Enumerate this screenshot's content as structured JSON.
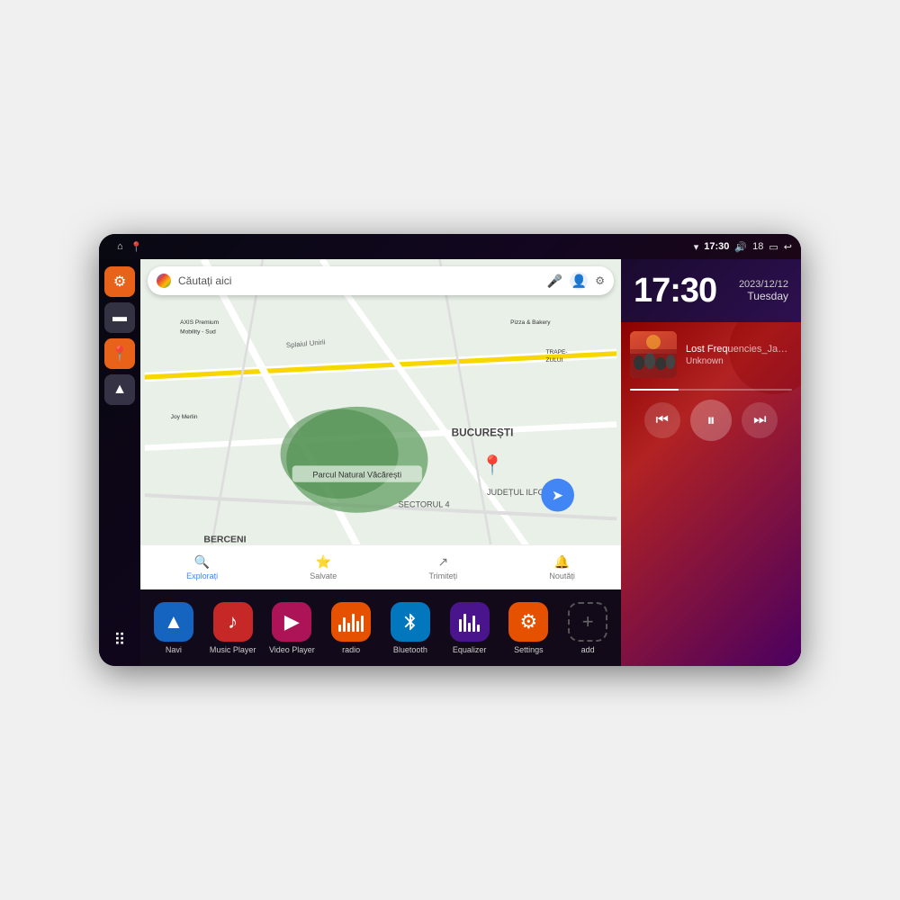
{
  "device": {
    "status_bar": {
      "wifi_icon": "▼",
      "time": "17:30",
      "volume_icon": "🔊",
      "battery_level": "18",
      "battery_icon": "🔋",
      "back_icon": "↩"
    },
    "sidebar": {
      "settings_icon": "⚙",
      "folder_icon": "📁",
      "map_icon": "📍",
      "nav_icon": "▲",
      "apps_icon": "⠿"
    },
    "map": {
      "search_placeholder": "Căutați aici",
      "locations": [
        "AXIS Premium Mobility - Sud",
        "Pizza & Bakery",
        "Parcul Natural Văcărești",
        "BUCUREȘTI",
        "SECTORUL 4",
        "BERCENI",
        "JUDEȚUL ILFOV",
        "TRAPEZULUI"
      ],
      "nav_items": [
        {
          "label": "Explorați",
          "icon": "🔍",
          "active": true
        },
        {
          "label": "Salvate",
          "icon": "⭐",
          "active": false
        },
        {
          "label": "Trimiteți",
          "icon": "↗",
          "active": false
        },
        {
          "label": "Noutăți",
          "icon": "🔔",
          "active": false
        }
      ]
    },
    "clock": {
      "time": "17:30",
      "date": "2023/12/12",
      "day": "Tuesday"
    },
    "music": {
      "title": "Lost Frequencies_Janie...",
      "artist": "Unknown",
      "progress": 30
    },
    "apps": [
      {
        "label": "Navi",
        "icon": "▲",
        "color": "blue"
      },
      {
        "label": "Music Player",
        "icon": "♪",
        "color": "red"
      },
      {
        "label": "Video Player",
        "icon": "▶",
        "color": "pink"
      },
      {
        "label": "radio",
        "icon": "eq",
        "color": "orange2"
      },
      {
        "label": "Bluetooth",
        "icon": "⚡",
        "color": "blue2"
      },
      {
        "label": "Equalizer",
        "icon": "eq2",
        "color": "purple"
      },
      {
        "label": "Settings",
        "icon": "⚙",
        "color": "settings-orange"
      },
      {
        "label": "add",
        "icon": "+",
        "color": "add-gray"
      }
    ]
  }
}
